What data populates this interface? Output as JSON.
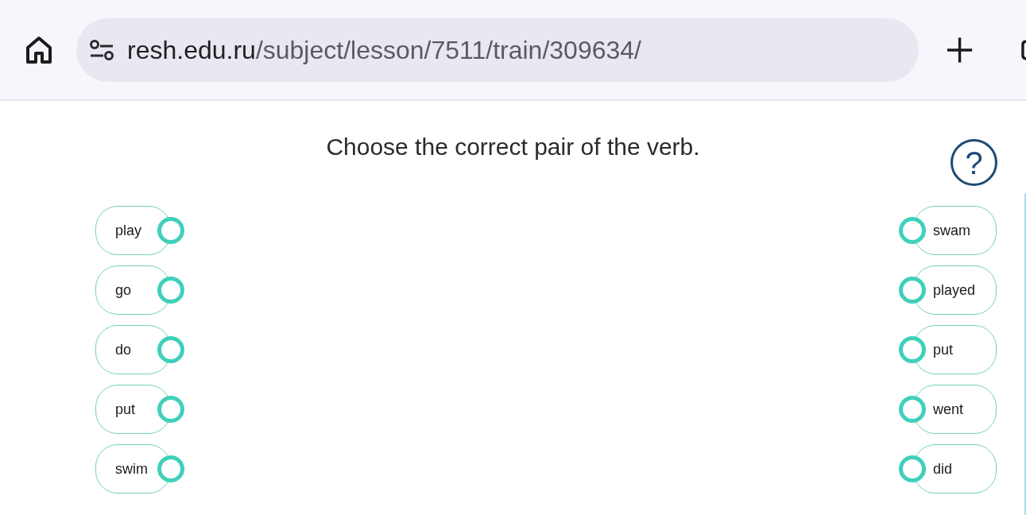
{
  "browser": {
    "url_host": "resh.edu.ru",
    "url_path": "/subject/lesson/7511/train/309634/"
  },
  "task": {
    "instruction": "Choose the correct pair of the verb.",
    "help_label": "?"
  },
  "left_items": [
    {
      "label": "play"
    },
    {
      "label": "go"
    },
    {
      "label": "do"
    },
    {
      "label": "put"
    },
    {
      "label": "swim"
    }
  ],
  "right_items": [
    {
      "label": "swam"
    },
    {
      "label": "played"
    },
    {
      "label": "put"
    },
    {
      "label": "went"
    },
    {
      "label": "did"
    }
  ]
}
